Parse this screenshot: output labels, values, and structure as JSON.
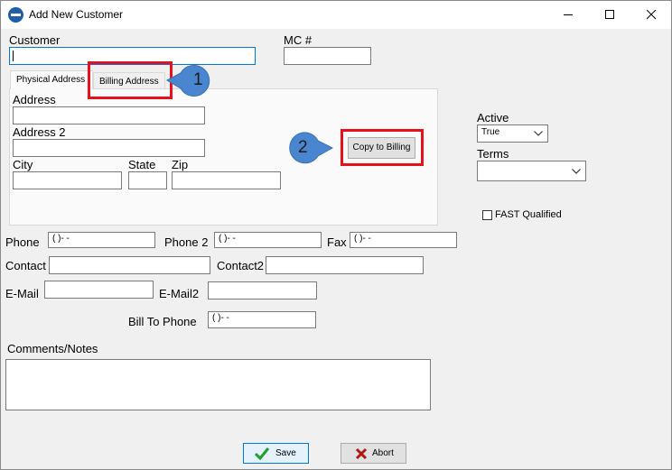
{
  "window": {
    "title": "Add New Customer",
    "minimize_icon": "minimize-icon",
    "maximize_icon": "maximize-icon",
    "close_icon": "close-icon"
  },
  "fields": {
    "customer": {
      "label": "Customer",
      "value": ""
    },
    "mc": {
      "label": "MC #",
      "value": ""
    },
    "address": {
      "label": "Address",
      "value": ""
    },
    "address2": {
      "label": "Address 2",
      "value": ""
    },
    "city": {
      "label": "City",
      "value": ""
    },
    "state": {
      "label": "State",
      "value": ""
    },
    "zip": {
      "label": "Zip",
      "value": ""
    },
    "phone": {
      "label": "Phone",
      "value": "(   )-   -"
    },
    "phone2": {
      "label": "Phone 2",
      "value": "(   )-   -"
    },
    "fax": {
      "label": "Fax",
      "value": "(   )-   -"
    },
    "contact": {
      "label": "Contact",
      "value": ""
    },
    "contact2": {
      "label": "Contact2",
      "value": ""
    },
    "email": {
      "label": "E-Mail",
      "value": ""
    },
    "email2": {
      "label": "E-Mail2",
      "value": ""
    },
    "bill_to_phone": {
      "label": "Bill To Phone",
      "value": "(   )-   -"
    },
    "comments": {
      "label": "Comments/Notes",
      "value": ""
    }
  },
  "tabs": [
    {
      "label": "Physical Address",
      "active": true
    },
    {
      "label": "Billing Address",
      "active": false
    }
  ],
  "copy_button": {
    "label": "Copy to Billing"
  },
  "active": {
    "label": "Active",
    "value": "True"
  },
  "terms": {
    "label": "Terms",
    "value": ""
  },
  "fast_qualified": {
    "label": "FAST Qualified",
    "checked": false
  },
  "callouts": [
    "1",
    "2"
  ],
  "buttons": {
    "save": "Save",
    "abort": "Abort"
  },
  "colors": {
    "highlight_red": "#e8101a",
    "callout_blue": "#4a86d0",
    "save_check_green": "#1e9e2e",
    "abort_x_red": "#b01818"
  }
}
